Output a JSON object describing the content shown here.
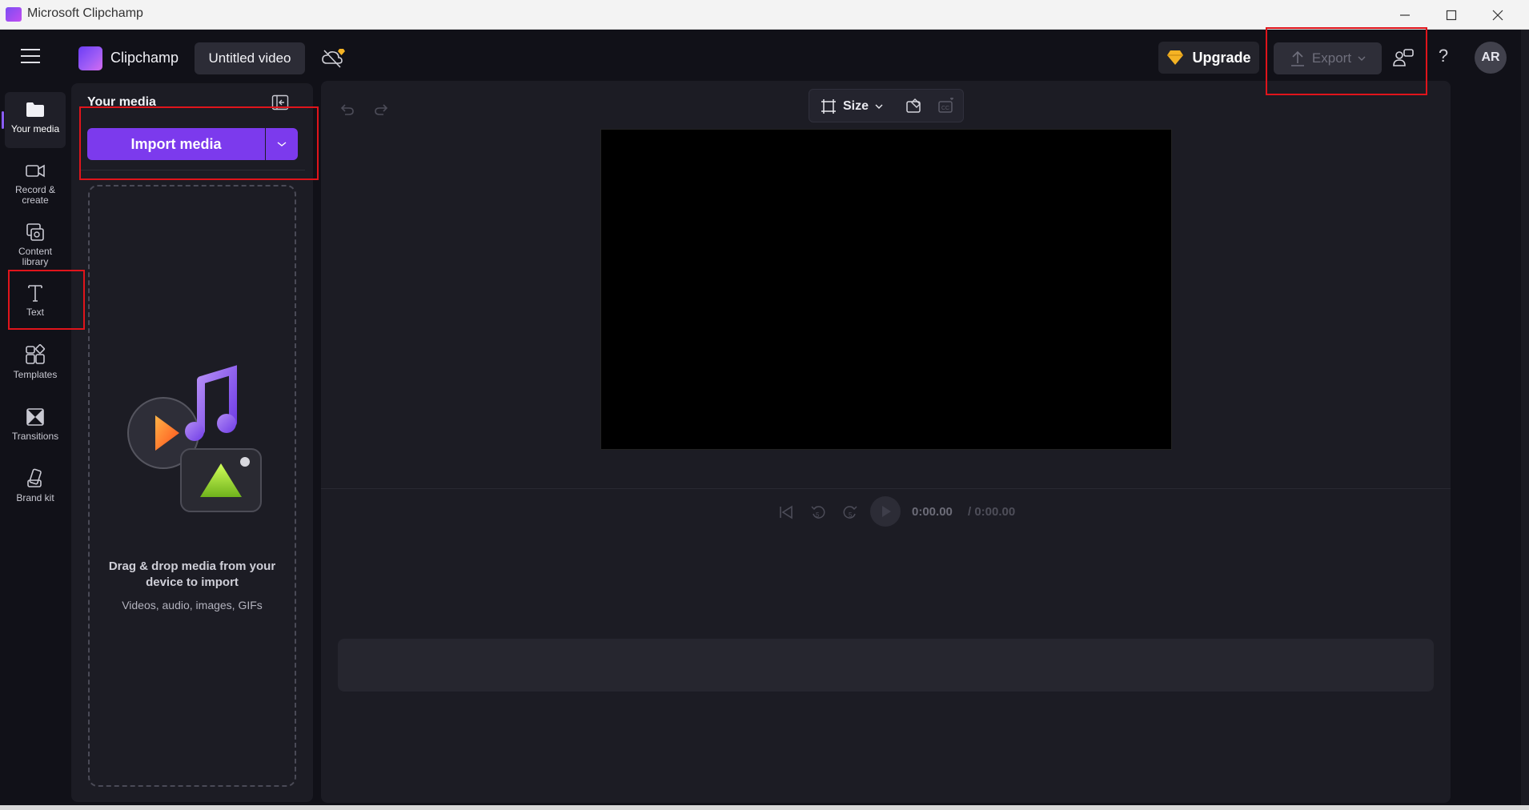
{
  "window": {
    "title": "Microsoft Clipchamp"
  },
  "topbar": {
    "brand": "Clipchamp",
    "project_title": "Untitled video",
    "upgrade_label": "Upgrade",
    "export_label": "Export",
    "avatar_initials": "AR",
    "help_glyph": "?"
  },
  "sidebar": {
    "items": [
      {
        "label": "Your media",
        "icon": "folder-icon"
      },
      {
        "label": "Record & create",
        "icon": "camera-icon"
      },
      {
        "label": "Content library",
        "icon": "library-icon"
      },
      {
        "label": "Text",
        "icon": "text-icon"
      },
      {
        "label": "Templates",
        "icon": "templates-icon"
      },
      {
        "label": "Transitions",
        "icon": "transitions-icon"
      },
      {
        "label": "Brand kit",
        "icon": "brand-kit-icon"
      }
    ]
  },
  "media_panel": {
    "title": "Your media",
    "import_label": "Import media",
    "drop_title": "Drag & drop media from your device to import",
    "drop_types": "Videos, audio, images, GIFs"
  },
  "editor": {
    "size_label": "Size",
    "time_current": "0:00.00",
    "time_total": "/ 0:00.00"
  },
  "colors": {
    "accent": "#7c3aed",
    "background": "#111118",
    "panel": "#1c1c24",
    "annotation": "#e0141b"
  }
}
